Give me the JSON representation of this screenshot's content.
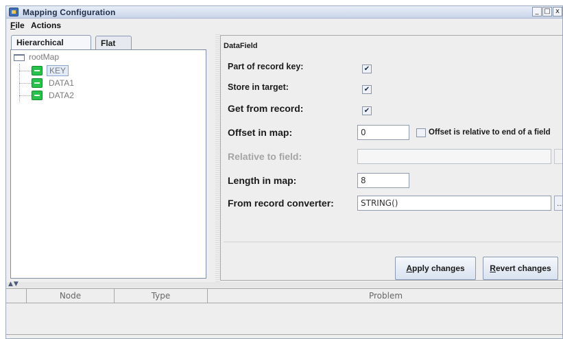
{
  "window": {
    "title": "Mapping Configuration",
    "controls": [
      "_",
      "□",
      "x"
    ]
  },
  "menu": {
    "file": {
      "mnemonic": "F",
      "rest": "ile"
    },
    "actions": "Actions"
  },
  "left": {
    "tabs": [
      {
        "label": "Hierarchical",
        "active": true
      },
      {
        "label": "Flat",
        "active": false
      }
    ],
    "tree": {
      "root": "rootMap",
      "children": [
        {
          "label": "KEY",
          "selected": true
        },
        {
          "label": "DATA1",
          "selected": false
        },
        {
          "label": "DATA2",
          "selected": false
        }
      ]
    }
  },
  "datafield": {
    "title": "DataField",
    "part_of_key_label": "Part of record key:",
    "part_of_key_checked": true,
    "store_in_target_label": "Store in target:",
    "store_in_target_checked": true,
    "get_from_record_label": "Get from record:",
    "get_from_record_checked": true,
    "offset_label": "Offset in map:",
    "offset_value": "0",
    "offset_relative_label": "Offset is relative to end of a field",
    "offset_relative_checked": false,
    "relative_to_label": "Relative to field:",
    "relative_to_value": "",
    "length_label": "Length in map:",
    "length_value": "8",
    "converter_label": "From record converter:",
    "converter_value": "STRING()",
    "ellipsis": "..."
  },
  "buttons": {
    "apply": {
      "mnemonic": "A",
      "rest": "pply changes"
    },
    "revert": {
      "mnemonic": "R",
      "rest": "evert changes"
    }
  },
  "splitter_arrows": "▲▼",
  "problems": {
    "columns": [
      "",
      "Node",
      "Type",
      "Problem"
    ],
    "rows": []
  },
  "colors": {
    "leaf_icon": "#27c24a",
    "selection": "#e2ebf8"
  }
}
